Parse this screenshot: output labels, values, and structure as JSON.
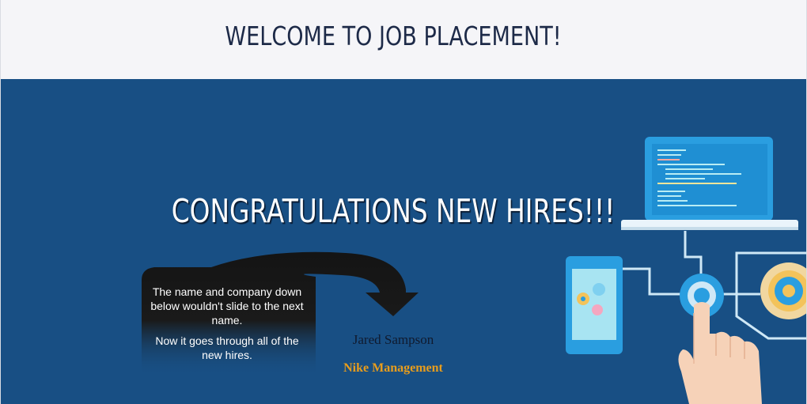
{
  "header": {
    "title": "WELCOME TO JOB PLACEMENT!"
  },
  "hero": {
    "title": "CONGRATULATIONS NEW HIRES!!!",
    "note": {
      "line1": "The name and company down below wouldn't slide to the next name.",
      "line2": "Now it goes through all of the new hires."
    },
    "hire": {
      "name": "Jared Sampson",
      "company": "Nike Management"
    }
  },
  "colors": {
    "header_bg": "#f5f5f8",
    "hero_bg": "#184f84",
    "title_dark": "#1d2a48",
    "company_accent": "#e89d1c"
  }
}
